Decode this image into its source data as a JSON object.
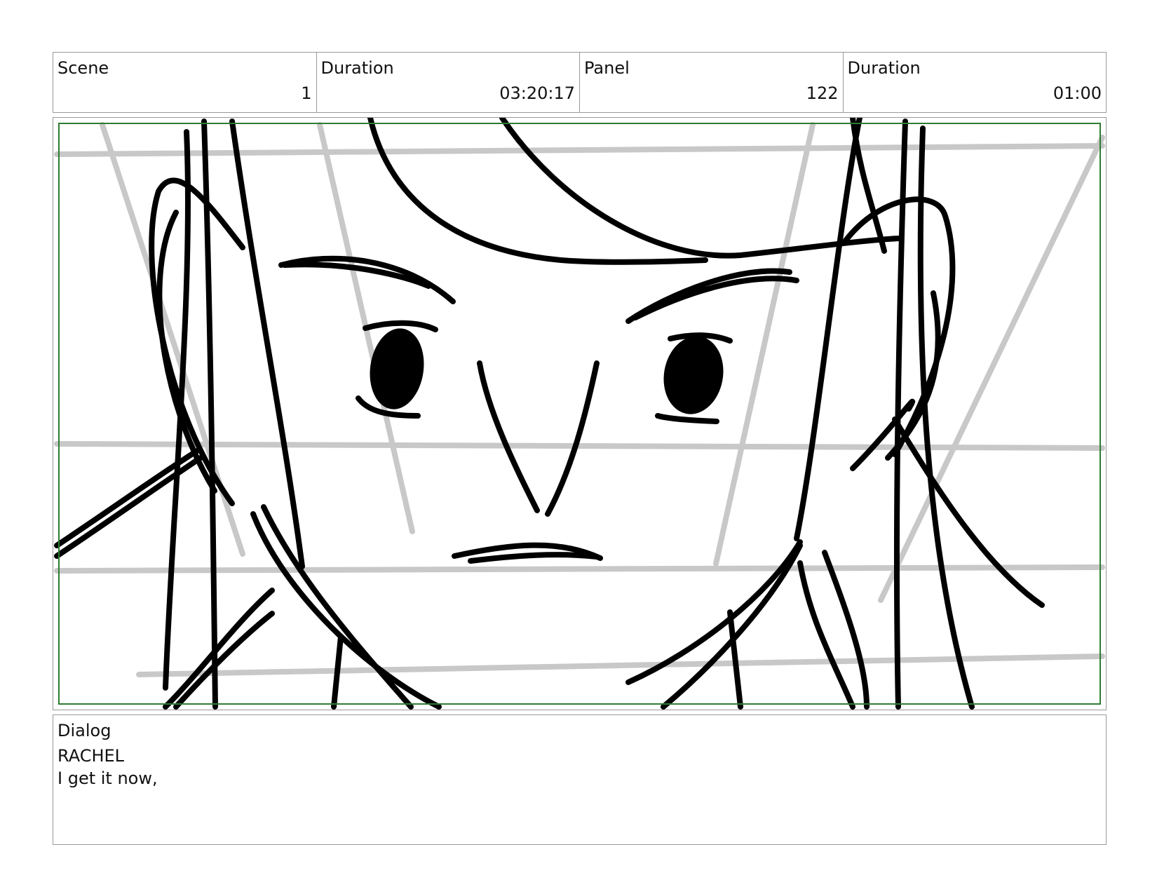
{
  "header": {
    "scene": {
      "label": "Scene",
      "value": "1"
    },
    "scene_duration": {
      "label": "Duration",
      "value": "03:20:17"
    },
    "panel": {
      "label": "Panel",
      "value": "122"
    },
    "panel_duration": {
      "label": "Duration",
      "value": "01:00"
    }
  },
  "dialog": {
    "label": "Dialog",
    "speaker": "RACHEL",
    "line": "I get it now,"
  },
  "colors": {
    "border": "#9a9a9a",
    "safe_frame": "#2e7d32",
    "sketch_ink": "#000000",
    "perspective_grid": "#c8c8c8"
  }
}
